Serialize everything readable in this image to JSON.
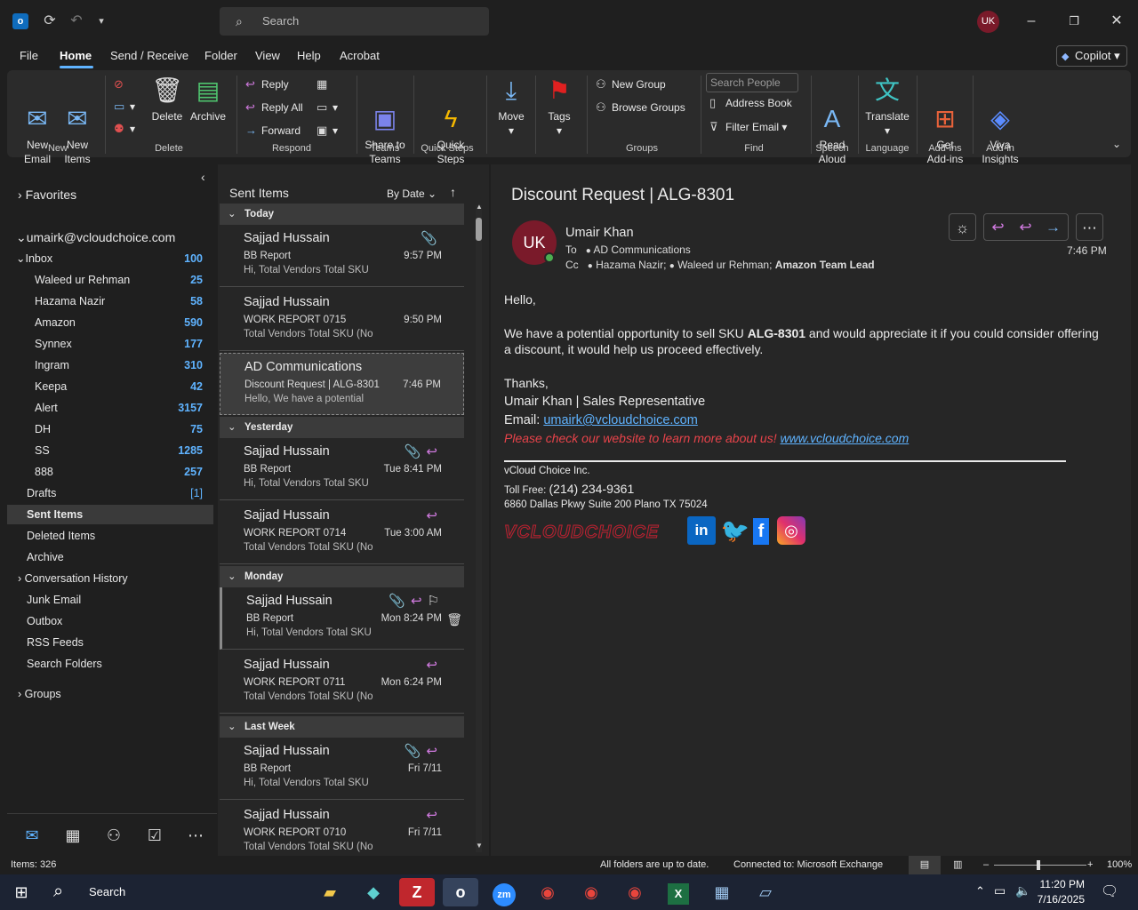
{
  "titlebar": {
    "search_placeholder": "Search",
    "avatar_initials": "UK"
  },
  "menu": [
    "File",
    "Home",
    "Send / Receive",
    "Folder",
    "View",
    "Help",
    "Acrobat"
  ],
  "copilot_label": "Copilot",
  "ribbon": {
    "new_email": "New\nEmail",
    "new_items": "New\nItems",
    "delete": "Delete",
    "archive": "Archive",
    "reply": "Reply",
    "reply_all": "Reply All",
    "forward": "Forward",
    "share_to_teams": "Share to\nTeams",
    "quick_steps": "Quick\nSteps",
    "move": "Move",
    "tags": "Tags",
    "new_group": "New Group",
    "browse_groups": "Browse Groups",
    "search_people_placeholder": "Search People",
    "address_book": "Address Book",
    "filter_email": "Filter Email",
    "read_aloud": "Read\nAloud",
    "translate": "Translate",
    "get_addins": "Get\nAdd-ins",
    "viva_insights": "Viva\nInsights",
    "groups": {
      "new": "New",
      "delete": "Delete",
      "respond": "Respond",
      "teams": "Teams",
      "quick_steps": "Quick Steps",
      "groups": "Groups",
      "find": "Find",
      "speech": "Speech",
      "language": "Language",
      "addins": "Add-ins",
      "addin": "Add-in"
    }
  },
  "nav": {
    "favorites": "Favorites",
    "account": "umairk@vcloudchoice.com",
    "inbox": {
      "label": "Inbox",
      "count": "100"
    },
    "subfolders": [
      {
        "label": "Waleed ur Rehman",
        "count": "25"
      },
      {
        "label": "Hazama Nazir",
        "count": "58"
      },
      {
        "label": "Amazon",
        "count": "590"
      },
      {
        "label": "Synnex",
        "count": "177"
      },
      {
        "label": "Ingram",
        "count": "310"
      },
      {
        "label": "Keepa",
        "count": "42"
      },
      {
        "label": "Alert",
        "count": "3157"
      },
      {
        "label": "DH",
        "count": "75"
      },
      {
        "label": "SS",
        "count": "1285"
      },
      {
        "label": "888",
        "count": "257"
      }
    ],
    "drafts": {
      "label": "Drafts",
      "count": "[1]"
    },
    "sent_items": "Sent Items",
    "deleted_items": "Deleted Items",
    "archive": "Archive",
    "conversation_history": "Conversation History",
    "junk_email": "Junk Email",
    "outbox": "Outbox",
    "rss_feeds": "RSS Feeds",
    "search_folders": "Search Folders",
    "groups": "Groups"
  },
  "list": {
    "title": "Sent Items",
    "sort": "By Date",
    "groups": [
      "Today",
      "Yesterday",
      "Monday",
      "Last Week"
    ],
    "messages": [
      {
        "from": "Sajjad Hussain",
        "subject": "BB Report",
        "preview": "Hi,  Total Vendors  Total SKU",
        "time": "9:57 PM"
      },
      {
        "from": "Sajjad Hussain",
        "subject": "WORK REPORT 0715",
        "preview": "Total Vendors  Total SKU (No",
        "time": "9:50 PM"
      },
      {
        "from": "AD Communications",
        "subject": "Discount Request | ALG-8301",
        "preview": "Hello,   We have a potential",
        "time": "7:46 PM"
      },
      {
        "from": "Sajjad Hussain",
        "subject": "BB Report",
        "preview": "Hi,  Total Vendors  Total SKU",
        "time": "Tue 8:41 PM"
      },
      {
        "from": "Sajjad Hussain",
        "subject": "WORK REPORT 0714",
        "preview": "Total Vendors  Total SKU (No",
        "time": "Tue 3:00 AM"
      },
      {
        "from": "Sajjad Hussain",
        "subject": "BB Report",
        "preview": "Hi,  Total Vendors  Total SKU",
        "time": "Mon 8:24 PM"
      },
      {
        "from": "Sajjad Hussain",
        "subject": "WORK REPORT 0711",
        "preview": "Total Vendors  Total SKU (No",
        "time": "Mon 6:24 PM"
      },
      {
        "from": "Sajjad Hussain",
        "subject": "BB Report",
        "preview": "Hi,  Total Vendors  Total SKU",
        "time": "Fri 7/11"
      },
      {
        "from": "Sajjad Hussain",
        "subject": "WORK REPORT 0710",
        "preview": "Total Vendors  Total SKU (No",
        "time": "Fri 7/11"
      }
    ]
  },
  "email": {
    "subject": "Discount Request | ALG-8301",
    "sender_initials": "UK",
    "sender": "Umair Khan",
    "to_label": "To",
    "to": "AD Communications",
    "cc_label": "Cc",
    "cc1": "Hazama Nazir;",
    "cc2": "Waleed ur Rehman;",
    "cc3": "Amazon Team Lead",
    "time": "7:46 PM",
    "greeting": "Hello,",
    "body_pre": "We have a potential opportunity to sell SKU ",
    "body_sku": "ALG-8301",
    "body_post": " and would appreciate it if you could consider offering a discount, it would help us proceed effectively.",
    "thanks": "Thanks,",
    "sig_name": "Umair Khan | Sales Representative",
    "sig_email_label": "Email: ",
    "sig_email": "umairk@vcloudchoice.com",
    "sig_promo": "Please check our website to learn more about us! ",
    "sig_site": "www.vcloudchoice.com",
    "company": "vCloud Choice Inc.",
    "tollfree_label": "Toll Free: ",
    "tollfree": "(214) 234-9361",
    "address": "6860 Dallas Pkwy Suite 200 Plano TX 75024",
    "logo_text": "VCLOUDCHOICE"
  },
  "status": {
    "items": "Items: 326",
    "sync": "All folders are up to date.",
    "connection": "Connected to: Microsoft Exchange",
    "zoom": "100%"
  },
  "taskbar": {
    "search": "Search",
    "time": "11:20 PM",
    "date": "7/16/2025"
  },
  "colors": {
    "accent": "#5fb3ff",
    "reply_icon": "#d07adf",
    "avatar": "#7a1a2a",
    "promo_red": "#e8434a"
  }
}
